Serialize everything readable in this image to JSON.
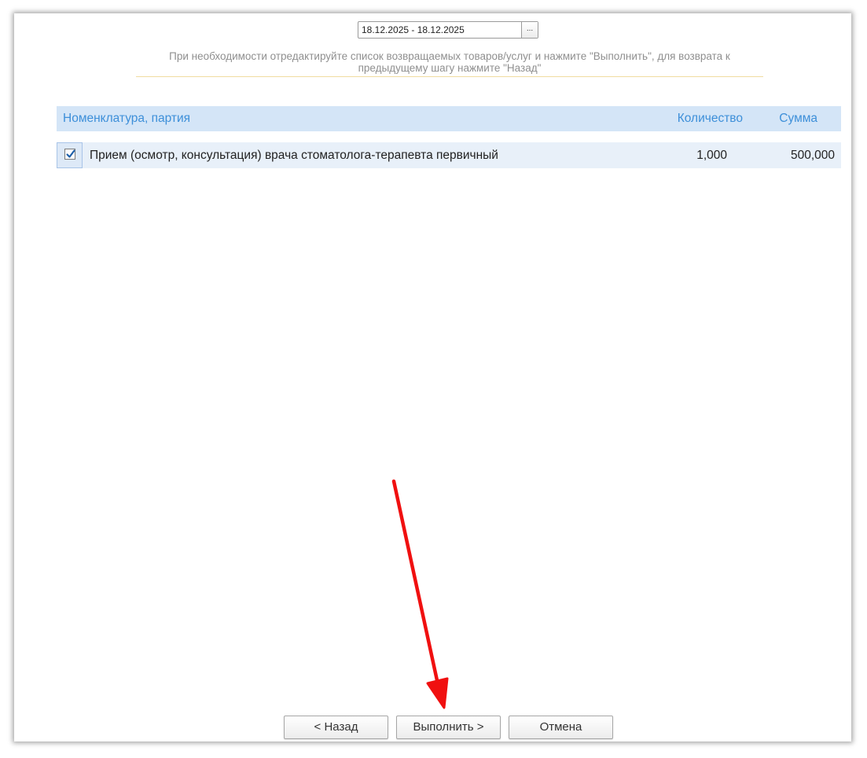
{
  "period": {
    "value": "18.12.2025 - 18.12.2025",
    "picker_label": "..."
  },
  "hint": "При необходимости отредактируйте список возвращаемых товаров/услуг и нажмите \"Выполнить\", для возврата к предыдущему шагу нажмите \"Назад\"",
  "table": {
    "columns": {
      "name": "Номенклатура, партия",
      "quantity": "Количество",
      "sum": "Сумма"
    },
    "rows": [
      {
        "checked": true,
        "name": "Прием (осмотр, консультация) врача стоматолога-терапевта первичный",
        "quantity": "1,000",
        "sum": "500,000"
      }
    ]
  },
  "buttons": {
    "back": "< Назад",
    "run": "Выполнить >",
    "cancel": "Отмена"
  },
  "colors": {
    "header_bg": "#d4e5f7",
    "header_text": "#3d8fd9",
    "row_bg": "#e8f0f9",
    "annotation_arrow": "#f01010"
  }
}
